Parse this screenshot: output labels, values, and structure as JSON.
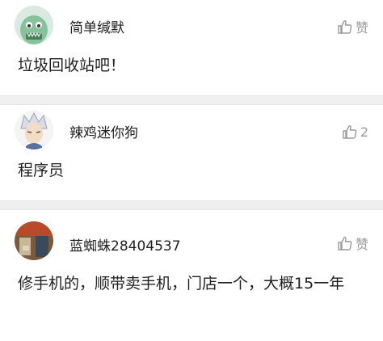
{
  "comments": [
    {
      "user": "简单缄默",
      "like": "赞",
      "text": "垃圾回收站吧！"
    },
    {
      "user": "辣鸡迷你狗",
      "like": "2",
      "text": "程序员"
    },
    {
      "user": "蓝蜘蛛28404537",
      "like": "赞",
      "text": "修手机的，顺带卖手机，门店一个，大概15一年"
    }
  ],
  "colors": {
    "separator": "#f0f0f0",
    "muted": "#9a9a9a",
    "text": "#1f1f1f"
  },
  "icons": {
    "like": "thumbs-up-icon"
  }
}
